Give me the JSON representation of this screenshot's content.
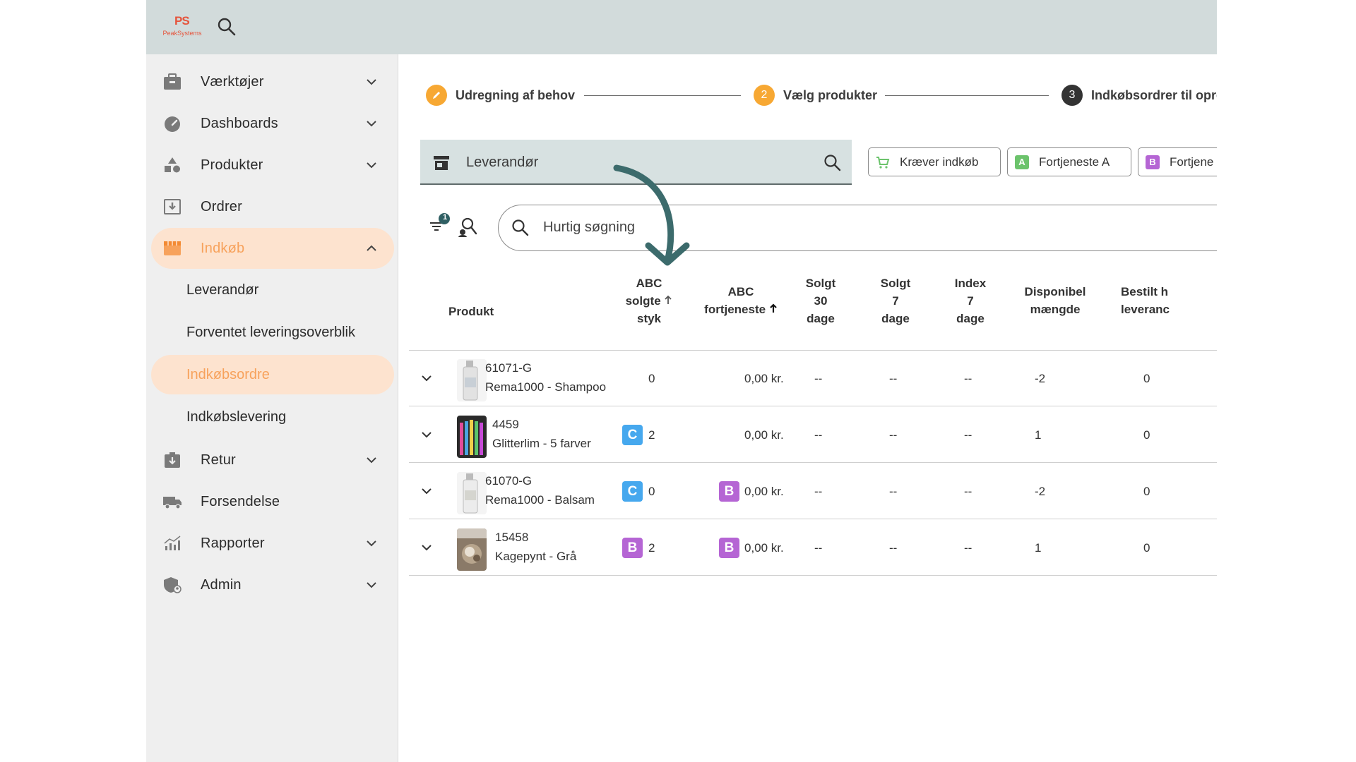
{
  "brand": {
    "logo_mark": "PS",
    "logo_text": "PeakSystems"
  },
  "colors": {
    "accent": "#f7a25c",
    "active_bg": "#fde3cf",
    "badge_c": "#46a8ee",
    "badge_b": "#b565d4",
    "badge_a": "#6cc36c",
    "topbar": "#d2dbdb",
    "arrow": "#3c6b6c"
  },
  "sidebar": {
    "items": [
      {
        "label": "Værktøjer",
        "icon": "toolbox-icon"
      },
      {
        "label": "Dashboards",
        "icon": "gauge-icon"
      },
      {
        "label": "Produkter",
        "icon": "shapes-icon"
      },
      {
        "label": "Ordrer",
        "icon": "order-icon"
      },
      {
        "label": "Indkøb",
        "icon": "store-icon"
      },
      {
        "label": "Retur",
        "icon": "return-icon"
      },
      {
        "label": "Forsendelse",
        "icon": "truck-icon"
      },
      {
        "label": "Rapporter",
        "icon": "chart-icon"
      },
      {
        "label": "Admin",
        "icon": "shield-user-icon"
      }
    ],
    "subitems": [
      {
        "label": "Leverandør"
      },
      {
        "label": "Forventet leveringsoverblik"
      },
      {
        "label": "Indkøbsordre"
      },
      {
        "label": "Indkøbslevering"
      }
    ]
  },
  "stepper": {
    "steps": [
      {
        "num": "",
        "label": "Udregning af behov",
        "state": "done"
      },
      {
        "num": "2",
        "label": "Vælg produkter",
        "state": "current"
      },
      {
        "num": "3",
        "label": "Indkøbsordrer til opre",
        "state": "pending"
      }
    ]
  },
  "supplier": {
    "placeholder": "Leverandør"
  },
  "chips": [
    {
      "icon": "cart-icon",
      "label": "Kræver indkøb"
    },
    {
      "icon_letter": "A",
      "label": "Fortjeneste A"
    },
    {
      "icon_letter": "B",
      "label": "Fortjene"
    }
  ],
  "filter": {
    "badge_count": "1"
  },
  "quick_search": {
    "placeholder": "Hurtig søgning"
  },
  "table": {
    "headers": {
      "produkt": "Produkt",
      "abc_sold": [
        "ABC",
        "solgte",
        "styk"
      ],
      "abc_profit": [
        "ABC",
        "fortjeneste"
      ],
      "sold30": [
        "Solgt",
        "30",
        "dage"
      ],
      "sold7": [
        "Solgt",
        "7",
        "dage"
      ],
      "index7": [
        "Index",
        "7",
        "dage"
      ],
      "available": [
        "Disponibel",
        "mængde"
      ],
      "ordered": [
        "Bestilt h",
        "leveranc"
      ]
    },
    "rows": [
      {
        "sku": "61071-G",
        "name": "Rema1000 - Shampoo",
        "abc_sold_grade": "",
        "abc_sold": "0",
        "abc_profit_grade": "",
        "abc_profit": "0,00 kr.",
        "sold30": "--",
        "sold7": "--",
        "index7": "--",
        "available": "-2",
        "ordered": "0"
      },
      {
        "sku": "4459",
        "name": "Glitterlim - 5 farver",
        "abc_sold_grade": "C",
        "abc_sold": "2",
        "abc_profit_grade": "",
        "abc_profit": "0,00 kr.",
        "sold30": "--",
        "sold7": "--",
        "index7": "--",
        "available": "1",
        "ordered": "0"
      },
      {
        "sku": "61070-G",
        "name": "Rema1000 - Balsam",
        "abc_sold_grade": "C",
        "abc_sold": "0",
        "abc_profit_grade": "B",
        "abc_profit": "0,00 kr.",
        "sold30": "--",
        "sold7": "--",
        "index7": "--",
        "available": "-2",
        "ordered": "0"
      },
      {
        "sku": "15458",
        "name": "Kagepynt - Grå",
        "abc_sold_grade": "B",
        "abc_sold": "2",
        "abc_profit_grade": "B",
        "abc_profit": "0,00 kr.",
        "sold30": "--",
        "sold7": "--",
        "index7": "--",
        "available": "1",
        "ordered": "0"
      }
    ]
  }
}
